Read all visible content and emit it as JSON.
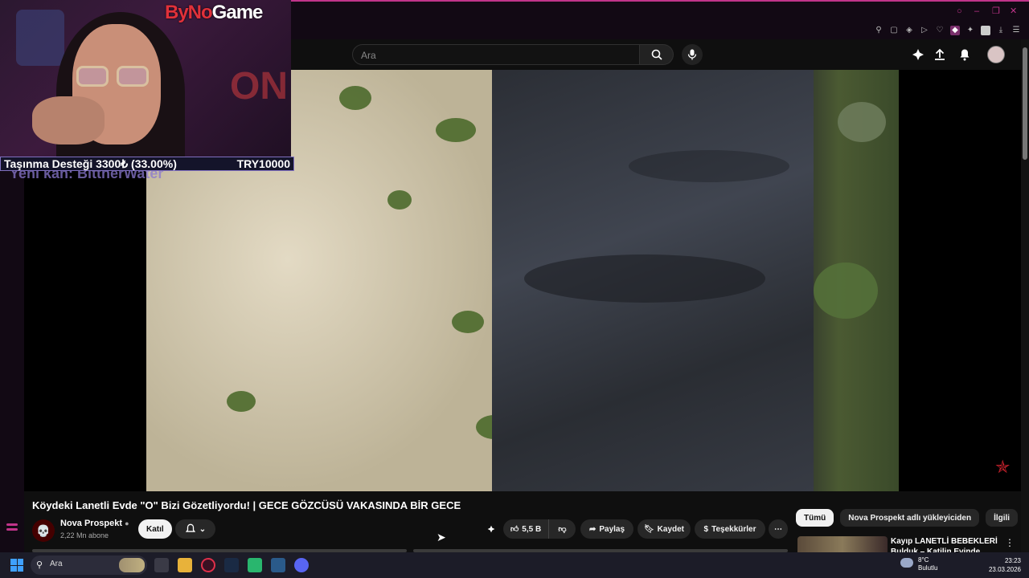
{
  "overlay": {
    "logo_prefix": "ByNo",
    "logo_suffix": "Game",
    "donation_text": "Taşınma Desteği 3300₺ (33.00%)",
    "donation_goal": "TRY10000",
    "donation_progress": 0.33,
    "new_sub_text": "Yeni kan: BittnerWater"
  },
  "youtube": {
    "search_placeholder": "Ara",
    "video_title": "Köydeki Lanetli Evde \"O\" Bizi Gözetliyordu! | GECE GÖZCÜSÜ VAKASINDA BİR GECE",
    "channel_name": "Nova Prospekt",
    "subscribers": "2,22 Mn abone",
    "join_label": "Katıl",
    "likes": "5,5 B",
    "share_label": "Paylaş",
    "save_label": "Kaydet",
    "thanks_label": "Teşekkürler",
    "chips": [
      "Tümü",
      "Nova Prospekt adlı yükleyiciden",
      "İlgili"
    ],
    "rec_title": "Kayıp LANETLİ BEBEKLERİ Bulduk – Katilin Evinde Korkun"
  },
  "taskbar": {
    "search_label": "Ara",
    "weather_temp": "8°C",
    "weather_desc": "Bulutlu",
    "time": "23:23",
    "date": "23.03.2026"
  },
  "colors": {
    "accent": "#c0348a",
    "logo_red": "#e1313a",
    "yt_bg": "#0f0f0f"
  }
}
